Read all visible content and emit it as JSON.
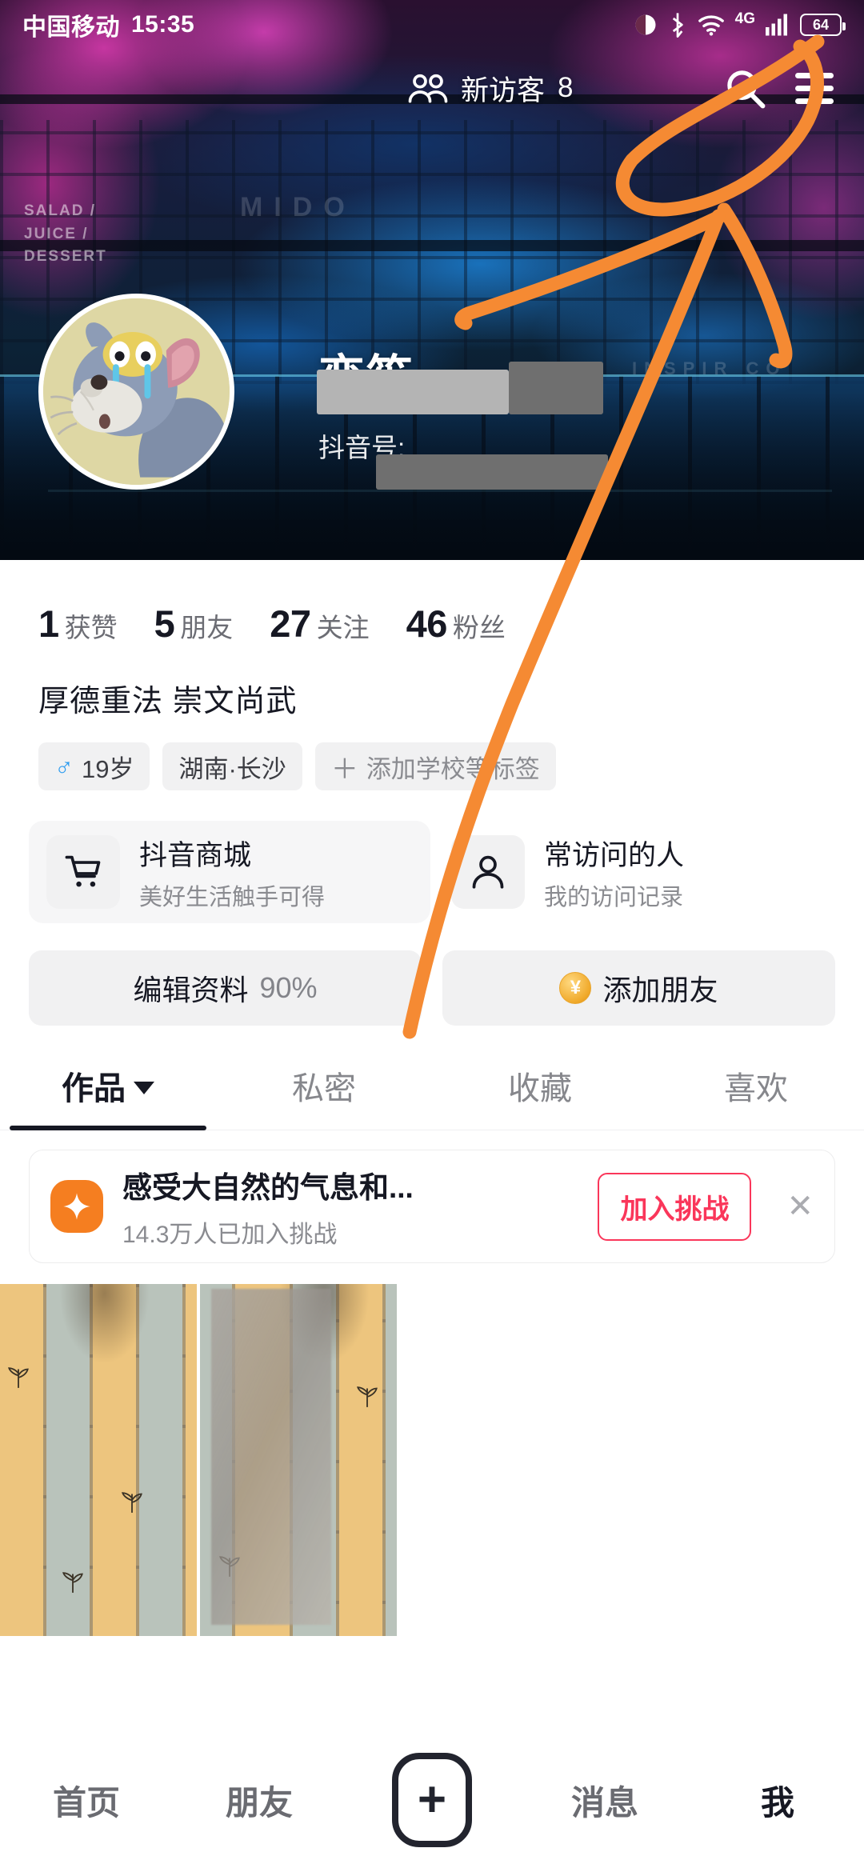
{
  "status_bar": {
    "carrier": "中国移动",
    "time": "15:35",
    "network": "4G",
    "battery_level": "64",
    "icons": [
      "eye-icon",
      "bluetooth-icon",
      "wifi-icon",
      "network-4g-icon",
      "signal-bars-icon",
      "battery-icon"
    ]
  },
  "cover": {
    "visitors_label": "新访客",
    "visitors_count": "8",
    "search_icon": "search-icon",
    "menu_icon": "hamburger-menu-icon",
    "cover_text_1": "MIDO",
    "cover_text_2": "INSPIR CO",
    "cover_text_3": "SALAD / JUICE / DESSERT"
  },
  "profile": {
    "avatar": "tom-cat-avatar",
    "username": "恋笙",
    "douyin_id_label": "抖音号:",
    "douyin_id_value": "",
    "bio": "厚德重法 崇文尚武",
    "stats": [
      {
        "num": "1",
        "label": "获赞"
      },
      {
        "num": "5",
        "label": "朋友"
      },
      {
        "num": "27",
        "label": "关注"
      },
      {
        "num": "46",
        "label": "粉丝"
      }
    ],
    "tags": [
      {
        "icon": "male-gender-icon",
        "label": "19岁"
      },
      {
        "icon": "",
        "label": "湖南·长沙"
      },
      {
        "icon": "plus-icon",
        "label": "添加学校等标签"
      }
    ]
  },
  "entries": [
    {
      "icon": "shopping-cart-icon",
      "title": "抖音商城",
      "subtitle": "美好生活触手可得"
    },
    {
      "icon": "person-icon",
      "title": "常访问的人",
      "subtitle": "我的访问记录"
    }
  ],
  "actions": {
    "edit_profile_label": "编辑资料",
    "edit_profile_percent": "90%",
    "add_friend_label": "添加朋友",
    "add_friend_icon": "yuan-coin-icon"
  },
  "tabs": [
    {
      "label": "作品",
      "active": true,
      "has_caret": true
    },
    {
      "label": "私密",
      "active": false,
      "has_caret": false
    },
    {
      "label": "收藏",
      "active": false,
      "has_caret": false
    },
    {
      "label": "喜欢",
      "active": false,
      "has_caret": false
    }
  ],
  "challenge_banner": {
    "icon": "sparkle-icon",
    "title": "感受大自然的气息和...",
    "subtitle": "14.3万人已加入挑战",
    "button_label": "加入挑战",
    "close_icon": "close-icon"
  },
  "videos": [
    {
      "name": "video-thumbnail-tiles-1"
    },
    {
      "name": "video-thumbnail-tiles-2"
    }
  ],
  "bottom_nav": [
    {
      "label": "首页",
      "active": false
    },
    {
      "label": "朋友",
      "active": false
    },
    {
      "label": "+",
      "active": false,
      "is_plus": true
    },
    {
      "label": "消息",
      "active": false
    },
    {
      "label": "我",
      "active": true
    }
  ],
  "annotation": {
    "color": "#F58A33",
    "description": "hand-drawn orange arrow circling the hamburger menu icon"
  }
}
